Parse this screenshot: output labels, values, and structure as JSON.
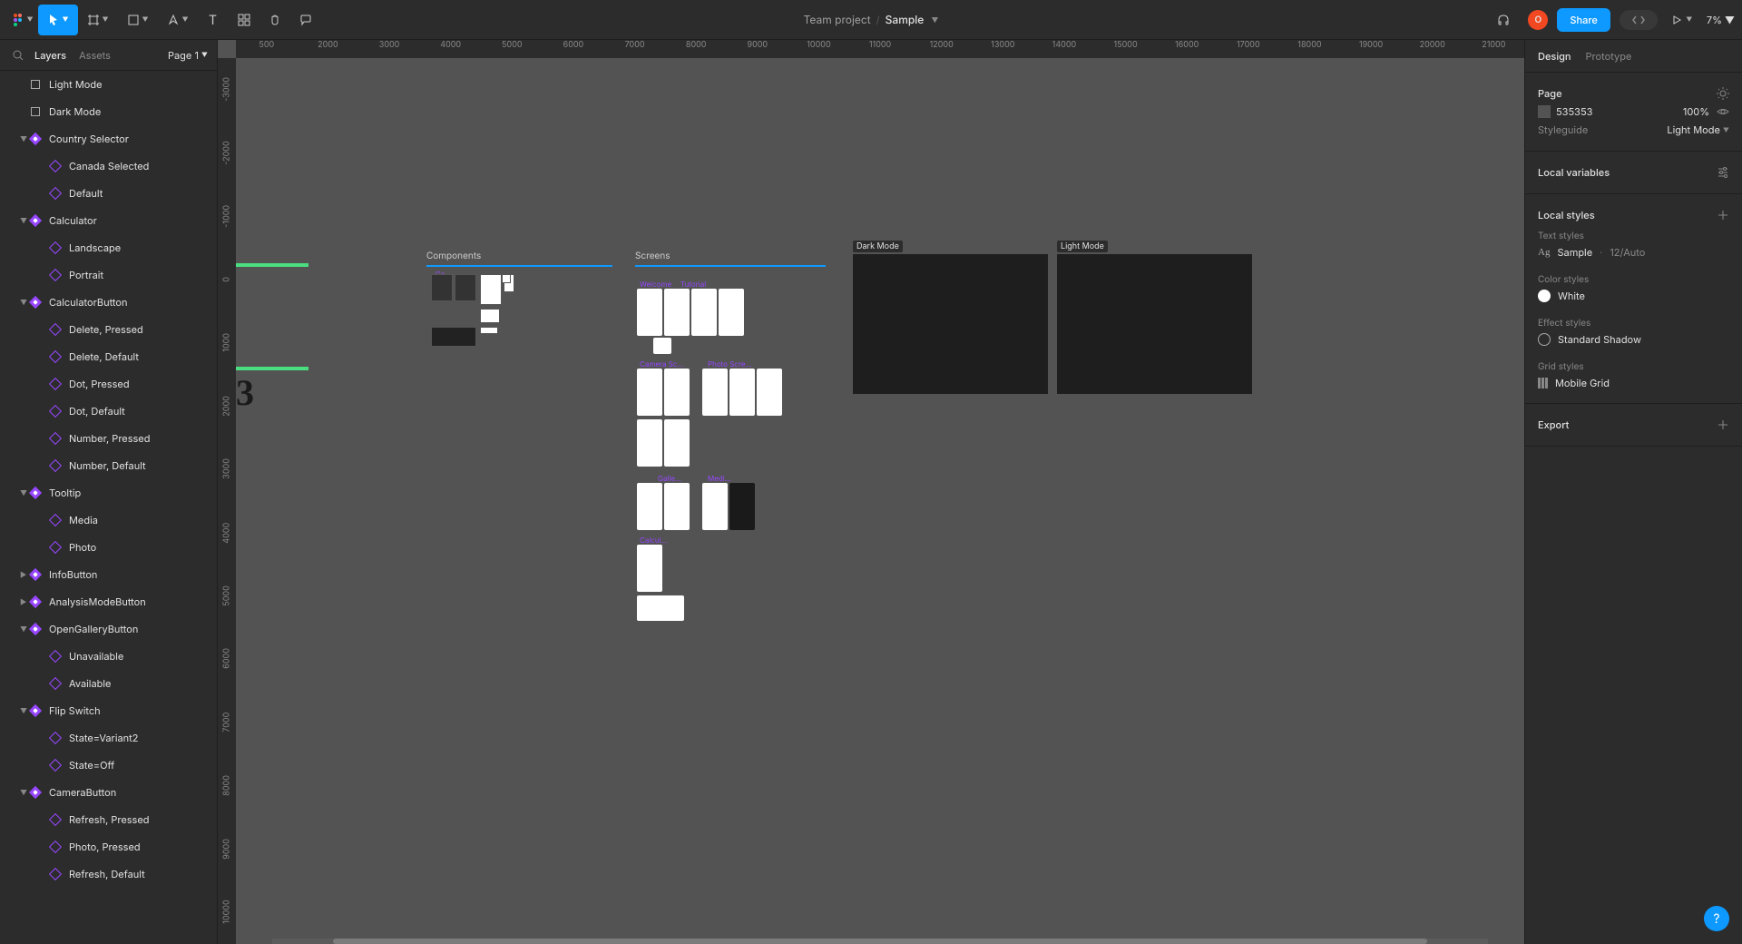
{
  "topbar": {
    "project_label": "Team project",
    "file_name": "Sample",
    "share_label": "Share",
    "avatar_initial": "O",
    "zoom_label": "7%"
  },
  "left_panel": {
    "tab_layers": "Layers",
    "tab_assets": "Assets",
    "page_selector": "Page 1",
    "tree": [
      {
        "type": "frame",
        "depth": 1,
        "label": "Light Mode"
      },
      {
        "type": "frame",
        "depth": 1,
        "label": "Dark Mode"
      },
      {
        "type": "compset",
        "depth": 1,
        "label": "Country Selector",
        "expanded": true
      },
      {
        "type": "component",
        "depth": 2,
        "label": "Canada Selected"
      },
      {
        "type": "component",
        "depth": 2,
        "label": "Default"
      },
      {
        "type": "compset",
        "depth": 1,
        "label": "Calculator",
        "expanded": true
      },
      {
        "type": "component",
        "depth": 2,
        "label": "Landscape"
      },
      {
        "type": "component",
        "depth": 2,
        "label": "Portrait"
      },
      {
        "type": "compset",
        "depth": 1,
        "label": "CalculatorButton",
        "expanded": true
      },
      {
        "type": "component",
        "depth": 2,
        "label": "Delete, Pressed"
      },
      {
        "type": "component",
        "depth": 2,
        "label": "Delete, Default"
      },
      {
        "type": "component",
        "depth": 2,
        "label": "Dot, Pressed"
      },
      {
        "type": "component",
        "depth": 2,
        "label": "Dot, Default"
      },
      {
        "type": "component",
        "depth": 2,
        "label": "Number, Pressed"
      },
      {
        "type": "component",
        "depth": 2,
        "label": "Number, Default"
      },
      {
        "type": "compset",
        "depth": 1,
        "label": "Tooltip",
        "expanded": true
      },
      {
        "type": "component",
        "depth": 2,
        "label": "Media"
      },
      {
        "type": "component",
        "depth": 2,
        "label": "Photo"
      },
      {
        "type": "compset",
        "depth": 1,
        "label": "InfoButton"
      },
      {
        "type": "compset",
        "depth": 1,
        "label": "AnalysisModeButton"
      },
      {
        "type": "compset",
        "depth": 1,
        "label": "OpenGalleryButton",
        "expanded": true
      },
      {
        "type": "component",
        "depth": 2,
        "label": "Unavailable"
      },
      {
        "type": "component",
        "depth": 2,
        "label": "Available"
      },
      {
        "type": "compset",
        "depth": 1,
        "label": "Flip Switch",
        "expanded": true
      },
      {
        "type": "component",
        "depth": 2,
        "label": "State=Variant2"
      },
      {
        "type": "component",
        "depth": 2,
        "label": "State=Off"
      },
      {
        "type": "compset",
        "depth": 1,
        "label": "CameraButton",
        "expanded": true
      },
      {
        "type": "component",
        "depth": 2,
        "label": "Refresh, Pressed"
      },
      {
        "type": "component",
        "depth": 2,
        "label": "Photo, Pressed"
      },
      {
        "type": "component",
        "depth": 2,
        "label": "Refresh, Default"
      }
    ]
  },
  "canvas": {
    "ruler_h": [
      "500",
      "2000",
      "3000",
      "4000",
      "5000",
      "6000",
      "7000",
      "8000",
      "9000",
      "10000",
      "11000",
      "12000",
      "13000",
      "14000",
      "15000",
      "16000",
      "17000",
      "18000",
      "19000",
      "20000",
      "21000"
    ],
    "ruler_v": [
      "-3000",
      "-2000",
      "-1000",
      "0",
      "1000",
      "2000",
      "3000",
      "4000",
      "5000",
      "6000",
      "7000",
      "8000",
      "9000",
      "10000"
    ],
    "section_components": "Components",
    "section_screens": "Screens",
    "frame_dark": "Dark Mode",
    "frame_light": "Light Mode",
    "label_welcome": "Welcome",
    "label_tutorial": "Tutorial",
    "label_camera": "Camera Sc…",
    "label_photo": "Photo Scre…",
    "label_gallery": "Galle…",
    "label_media": "Medi…",
    "label_calc": "Calcul…",
    "label_ca": "Ca…"
  },
  "right_panel": {
    "tab_design": "Design",
    "tab_prototype": "Prototype",
    "page_header": "Page",
    "bg_hex": "535353",
    "bg_opacity": "100%",
    "styleguide_label": "Styleguide",
    "styleguide_mode": "Light Mode",
    "local_variables": "Local variables",
    "local_styles": "Local styles",
    "text_styles_header": "Text styles",
    "text_style_prefix": "Ag",
    "text_style_name": "Sample",
    "text_style_detail": "12/Auto",
    "color_styles_header": "Color styles",
    "color_white": "White",
    "effect_styles_header": "Effect styles",
    "effect_shadow": "Standard Shadow",
    "grid_styles_header": "Grid styles",
    "grid_mobile": "Mobile Grid",
    "export_header": "Export"
  },
  "help": "?"
}
